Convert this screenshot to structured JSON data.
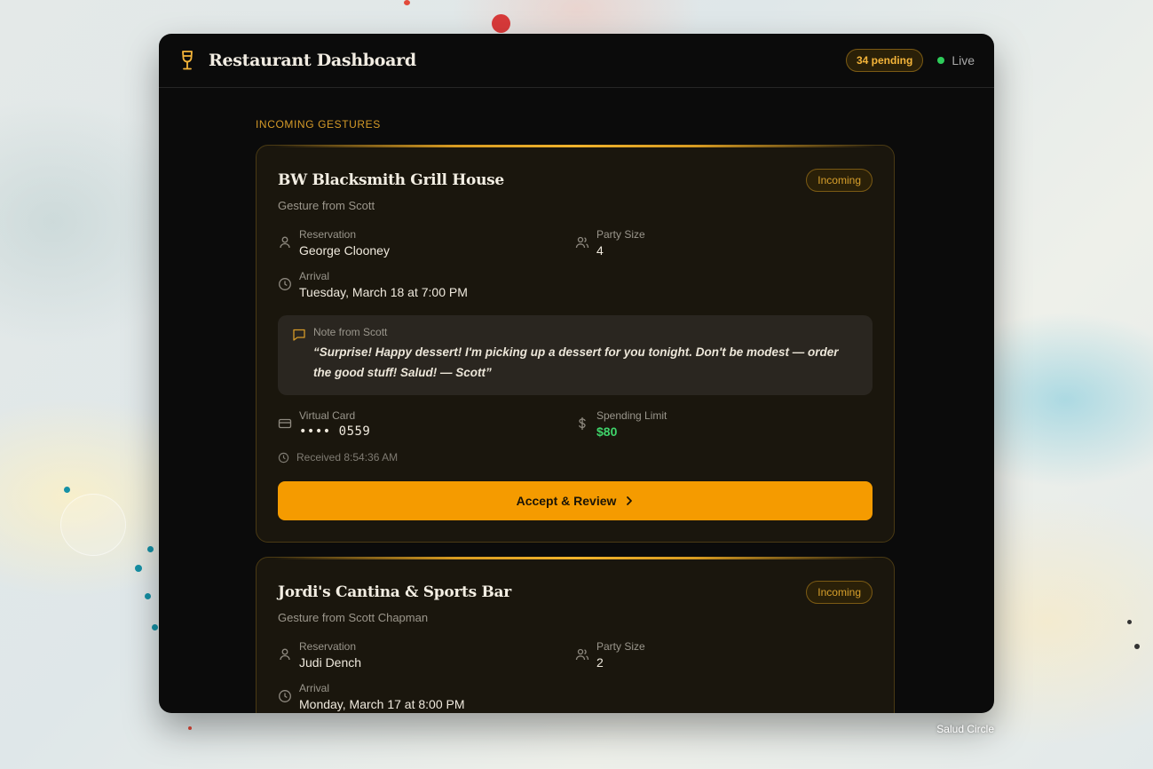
{
  "colors": {
    "accent": "#f59b00",
    "badge_text": "#f5b53a",
    "live": "#2ecc5a",
    "limit": "#3fd36a",
    "app_bg": "#0b0b0b",
    "card_bg": "#1a160d"
  },
  "header": {
    "icon": "wine-glass-icon",
    "title": "Restaurant Dashboard",
    "pending_badge": "34 pending",
    "live_label": "Live"
  },
  "main": {
    "section_label": "INCOMING GESTURES",
    "cards": [
      {
        "restaurant": "BW Blacksmith Grill House",
        "status": "Incoming",
        "from": "Gesture from Scott",
        "reservation_label": "Reservation",
        "reservation_value": "George Clooney",
        "party_label": "Party Size",
        "party_value": "4",
        "arrival_label": "Arrival",
        "arrival_value": "Tuesday, March 18 at 7:00 PM",
        "note_label": "Note from Scott",
        "note_text": "“Surprise! Happy dessert! I'm picking up a dessert for you tonight. Don't be modest — order the good stuff! Salud! — Scott”",
        "card_label": "Virtual Card",
        "card_value": "•••• 0559",
        "limit_label": "Spending Limit",
        "limit_value": "$80",
        "received": "Received 8:54:36 AM",
        "cta": "Accept & Review"
      },
      {
        "restaurant": "Jordi's Cantina & Sports Bar",
        "status": "Incoming",
        "from": "Gesture from Scott Chapman",
        "reservation_label": "Reservation",
        "reservation_value": "Judi Dench",
        "party_label": "Party Size",
        "party_value": "2",
        "arrival_label": "Arrival",
        "arrival_value": "Monday, March 17 at 8:00 PM"
      }
    ]
  },
  "footer": {
    "credit": "Salud Circle"
  }
}
